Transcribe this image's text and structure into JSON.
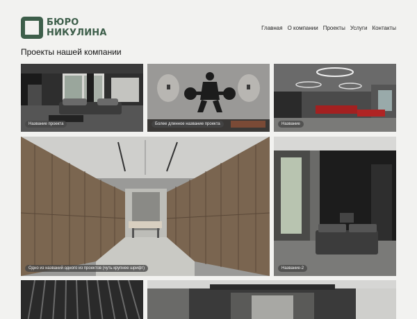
{
  "logo": {
    "line1": "БЮРО",
    "line2": "НИКУЛИНА"
  },
  "nav": [
    "Главная",
    "О компании",
    "Проекты",
    "Услуги",
    "Контакты"
  ],
  "page_title": "Проекты нашей компании",
  "projects": [
    {
      "caption": "Название проекта"
    },
    {
      "caption": "Более длинное название проекта"
    },
    {
      "caption": "Название"
    },
    {
      "caption": "Одно из названий одного из проектов (чуть крупнее шрифт)"
    },
    {
      "caption": "Название-2"
    }
  ],
  "colors": {
    "brand": "#3d5e4a",
    "background": "#f2f2f0",
    "caption_bg": "#464646"
  }
}
